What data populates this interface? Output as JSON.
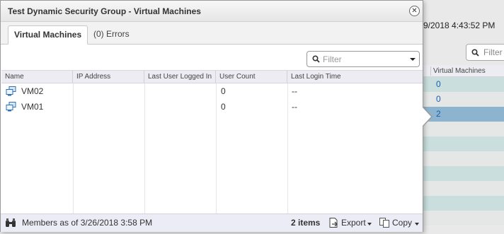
{
  "background": {
    "timestamp": "9/2018 4:43:52 PM",
    "filter_placeholder": "Filter",
    "column_header": "Virtual Machines",
    "rows": [
      "0",
      "0",
      "2",
      "",
      "",
      "",
      "",
      "",
      "",
      ""
    ],
    "colors": {
      "row_teal": "#c9dedd",
      "row_gray": "#e5e6e6",
      "row_selected": "#8db4cf",
      "link": "#1a5fb4"
    }
  },
  "dialog": {
    "title": "Test Dynamic Security Group - Virtual Machines",
    "close_icon": "close-icon",
    "tabs": [
      {
        "label": "Virtual Machines",
        "active": true
      },
      {
        "label": "(0) Errors",
        "active": false
      }
    ],
    "filter": {
      "placeholder": "Filter",
      "value": ""
    },
    "columns": [
      "Name",
      "IP Address",
      "Last User Logged In",
      "User Count",
      "Last Login Time"
    ],
    "rows": [
      {
        "icon": "virtual-machine-icon",
        "name": "VM02",
        "ip": "",
        "last_user": "",
        "user_count": "0",
        "last_login": "--"
      },
      {
        "icon": "virtual-machine-icon",
        "name": "VM01",
        "ip": "",
        "last_user": "",
        "user_count": "0",
        "last_login": "--"
      }
    ],
    "footer": {
      "members_icon": "binoculars-icon",
      "members_text": "Members as of 3/26/2018 3:58 PM",
      "items_count": "2 items",
      "export_label": "Export",
      "copy_label": "Copy"
    }
  }
}
